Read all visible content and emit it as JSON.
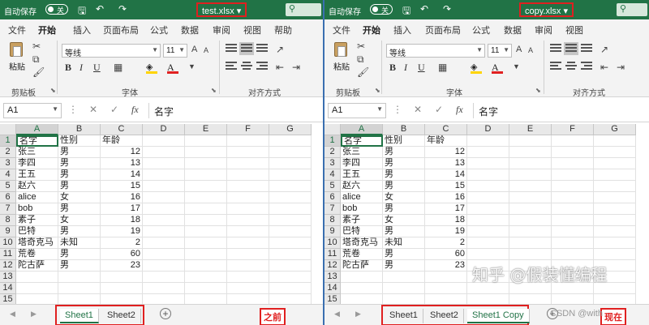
{
  "left": {
    "autosave_label": "自动保存",
    "autosave_state": "关",
    "file_name": "test.xlsx",
    "menu": [
      "文件",
      "开始",
      "插入",
      "页面布局",
      "公式",
      "数据",
      "审阅",
      "视图",
      "帮助"
    ],
    "ribbon": {
      "paste_label": "粘贴",
      "clipboard_label": "剪贴板",
      "font_group_label": "字体",
      "align_group_label": "对齐方式",
      "font_name": "等线",
      "font_size": "11"
    },
    "name_box": "A1",
    "formula_value": "名字",
    "sheets": [
      "Sheet1",
      "Sheet2"
    ],
    "active_sheet": "Sheet1",
    "caption": "之前"
  },
  "right": {
    "autosave_label": "自动保存",
    "autosave_state": "关",
    "file_name": "copy.xlsx",
    "menu": [
      "文件",
      "开始",
      "插入",
      "页面布局",
      "公式",
      "数据",
      "审阅",
      "视图"
    ],
    "ribbon": {
      "paste_label": "粘贴",
      "clipboard_label": "剪贴板",
      "font_group_label": "字体",
      "align_group_label": "对齐方式",
      "font_name": "等线",
      "font_size": "11"
    },
    "name_box": "A1",
    "formula_value": "名字",
    "sheets": [
      "Sheet1",
      "Sheet2",
      "Sheet1 Copy"
    ],
    "active_sheet": "Sheet1 Copy",
    "caption": "现在"
  },
  "columns": [
    "A",
    "B",
    "C",
    "D",
    "E",
    "F",
    "G"
  ],
  "rows": [
    "1",
    "2",
    "3",
    "4",
    "5",
    "6",
    "7",
    "8",
    "9",
    "10",
    "11",
    "12",
    "13",
    "14",
    "15"
  ],
  "table": [
    [
      "名字",
      "性别",
      "年龄"
    ],
    [
      "张三",
      "男",
      "12"
    ],
    [
      "李四",
      "男",
      "13"
    ],
    [
      "王五",
      "男",
      "14"
    ],
    [
      "赵六",
      "男",
      "15"
    ],
    [
      "alice",
      "女",
      "16"
    ],
    [
      "bob",
      "男",
      "17"
    ],
    [
      "素子",
      "女",
      "18"
    ],
    [
      "巴特",
      "男",
      "19"
    ],
    [
      "塔奇克马",
      "未知",
      "2"
    ],
    [
      "荒卷",
      "男",
      "60"
    ],
    [
      "陀古萨",
      "男",
      "23"
    ]
  ],
  "watermark": "知乎 @假装懂编程",
  "watermark_small": "CSDN @with",
  "colors": {
    "excel_green": "#217346",
    "highlight_red": "#e02020",
    "ribbon_bg": "#f3f3f3"
  },
  "icons": [
    "save-icon",
    "undo-icon",
    "redo-icon",
    "search-icon",
    "cut-icon",
    "copy-icon",
    "format-painter-icon",
    "bold-icon",
    "italic-icon",
    "underline-icon",
    "fill-color-icon",
    "font-color-icon",
    "align-left-icon",
    "align-center-icon",
    "align-right-icon",
    "cancel-icon",
    "enter-icon",
    "fx-icon",
    "add-sheet-icon"
  ]
}
